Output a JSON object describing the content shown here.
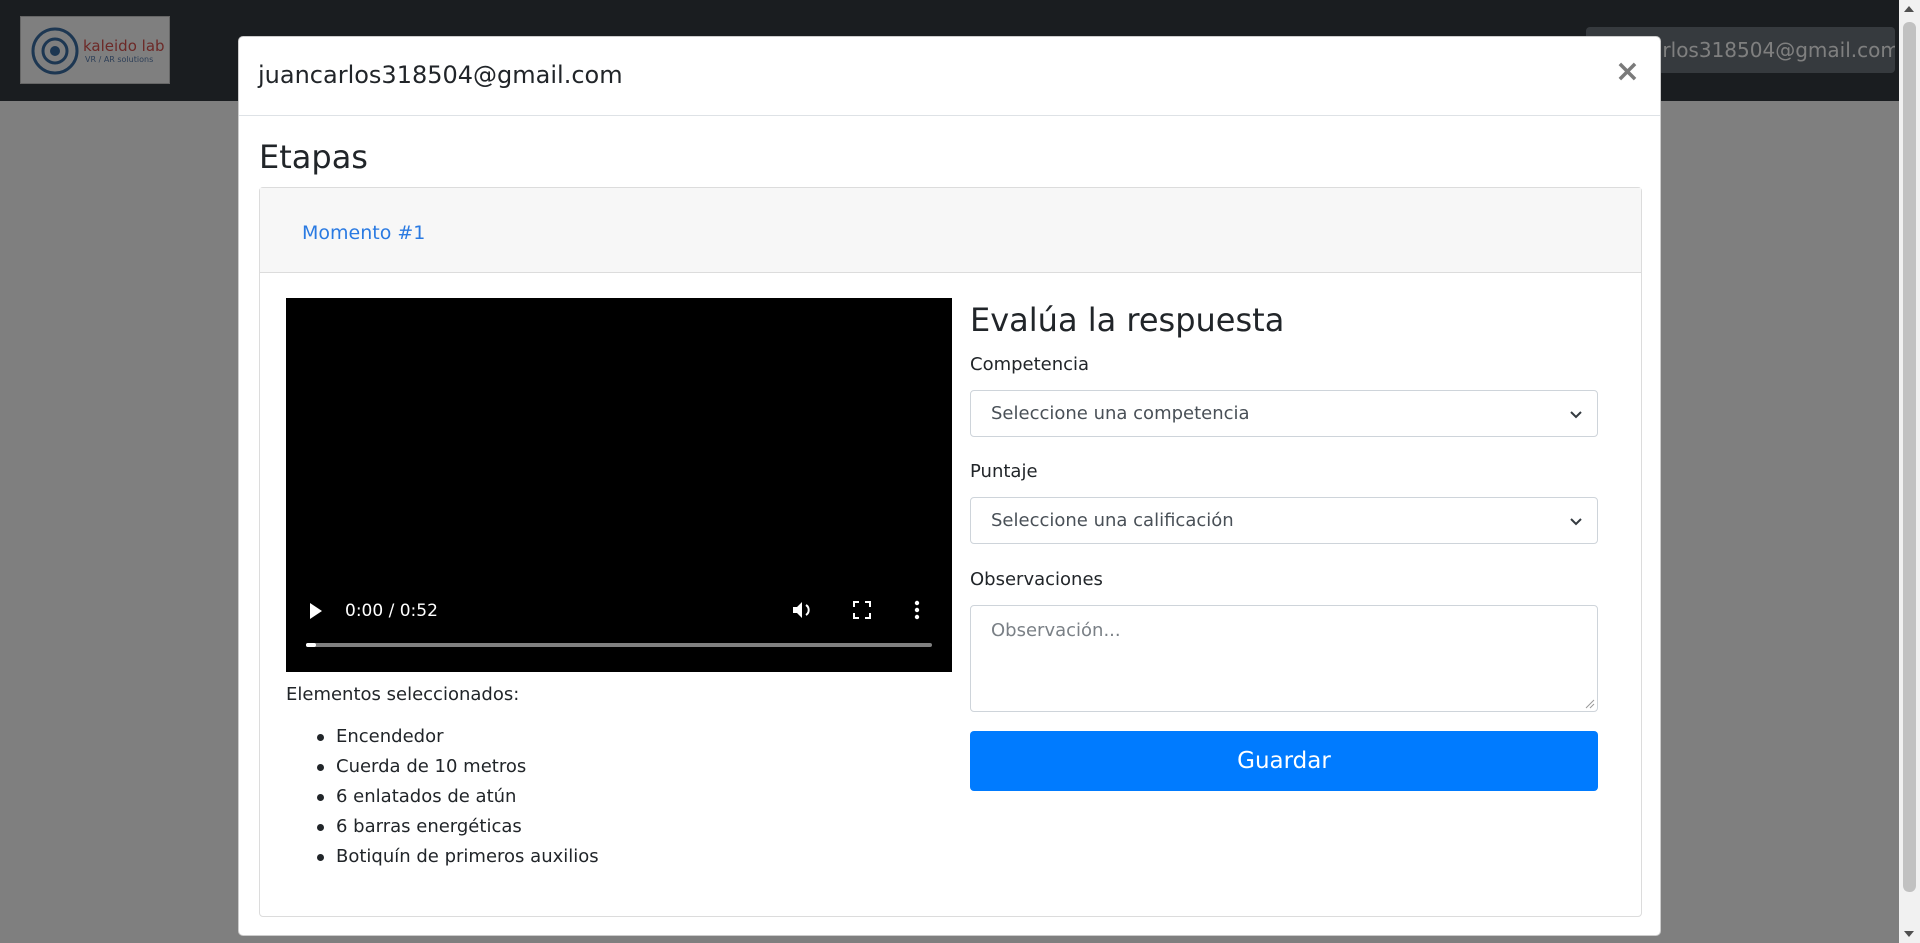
{
  "navbar": {
    "logo_text": "kaleido lab",
    "logo_sub": "VR / AR solutions",
    "user_email": "juancarlos318504@gmail.com"
  },
  "modal": {
    "title": "juancarlos318504@gmail.com",
    "close_label": "×",
    "section_title": "Etapas",
    "tabs": [
      {
        "label": "Momento #1"
      }
    ],
    "video": {
      "time": "0:00 / 0:52",
      "progress": 0.0
    },
    "selected_label": "Elementos seleccionados:",
    "items": [
      "Encendedor",
      "Cuerda de 10 metros",
      "6 enlatados de atún",
      "6 barras energéticas",
      "Botiquín de primeros auxilios"
    ],
    "eval": {
      "title": "Evalúa la respuesta",
      "competencia_label": "Competencia",
      "competencia_value": "Seleccione una competencia",
      "puntaje_label": "Puntaje",
      "puntaje_value": "Seleccione una calificación",
      "observaciones_label": "Observaciones",
      "observaciones_placeholder": "Observación...",
      "save_label": "Guardar"
    }
  },
  "colors": {
    "navbar": "#343a40",
    "primary": "#007bff",
    "link": "#2a7ae2"
  }
}
